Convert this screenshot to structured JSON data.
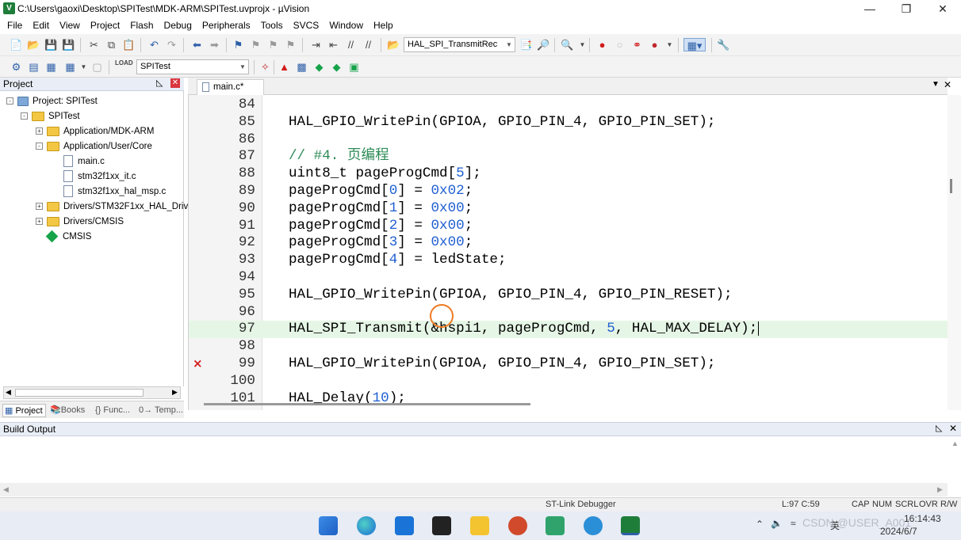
{
  "window": {
    "title": "C:\\Users\\gaoxi\\Desktop\\SPITest\\MDK-ARM\\SPITest.uvprojx - µVision",
    "icon": "V"
  },
  "watermark": "bilibili",
  "menu": [
    "File",
    "Edit",
    "View",
    "Project",
    "Flash",
    "Debug",
    "Peripherals",
    "Tools",
    "SVCS",
    "Window",
    "Help"
  ],
  "toolbar": {
    "find_combo": "HAL_SPI_TransmitRec",
    "target_combo": "SPITest"
  },
  "project_panel": {
    "title": "Project",
    "tree": [
      {
        "label": "Project: SPITest",
        "icon": "project-icon",
        "expander": "-"
      },
      {
        "label": "SPITest",
        "icon": "target-icon",
        "expander": "-"
      },
      {
        "label": "Application/MDK-ARM",
        "icon": "folder-icon",
        "expander": "+"
      },
      {
        "label": "Application/User/Core",
        "icon": "folder-icon",
        "expander": "-"
      },
      {
        "label": "main.c",
        "icon": "file-icon",
        "expander": ""
      },
      {
        "label": "stm32f1xx_it.c",
        "icon": "file-icon",
        "expander": ""
      },
      {
        "label": "stm32f1xx_hal_msp.c",
        "icon": "file-icon",
        "expander": ""
      },
      {
        "label": "Drivers/STM32F1xx_HAL_Driv",
        "icon": "folder-icon",
        "expander": "+"
      },
      {
        "label": "Drivers/CMSIS",
        "icon": "folder-icon",
        "expander": "+"
      },
      {
        "label": "CMSIS",
        "icon": "component-icon",
        "expander": ""
      }
    ],
    "tabs": [
      "Project",
      "Books",
      "{} Func...",
      "0→ Temp..."
    ]
  },
  "editor": {
    "tab_label": "main.c*",
    "lines": [
      {
        "num": "84",
        "text": ""
      },
      {
        "num": "85",
        "text": "HAL_GPIO_WritePin(GPIOA, GPIO_PIN_4, GPIO_PIN_SET);"
      },
      {
        "num": "86",
        "text": ""
      },
      {
        "num": "87",
        "text": "// #4. 页编程"
      },
      {
        "num": "88",
        "text": "uint8_t pageProgCmd[5];"
      },
      {
        "num": "89",
        "text": "pageProgCmd[0] = 0x02;"
      },
      {
        "num": "90",
        "text": "pageProgCmd[1] = 0x00;"
      },
      {
        "num": "91",
        "text": "pageProgCmd[2] = 0x00;"
      },
      {
        "num": "92",
        "text": "pageProgCmd[3] = 0x00;"
      },
      {
        "num": "93",
        "text": "pageProgCmd[4] = ledState;"
      },
      {
        "num": "94",
        "text": ""
      },
      {
        "num": "95",
        "text": "HAL_GPIO_WritePin(GPIOA, GPIO_PIN_4, GPIO_PIN_RESET);"
      },
      {
        "num": "96",
        "text": ""
      },
      {
        "num": "97",
        "text": "HAL_SPI_Transmit(&hspi1, pageProgCmd, 5, HAL_MAX_DELAY);"
      },
      {
        "num": "98",
        "text": ""
      },
      {
        "num": "99",
        "text": "HAL_GPIO_WritePin(GPIOA, GPIO_PIN_4, GPIO_PIN_SET);"
      },
      {
        "num": "100",
        "text": ""
      },
      {
        "num": "101",
        "text": "HAL_Delay(10);"
      }
    ],
    "highlight_line": "97",
    "error_line": "99",
    "error_marker": "×"
  },
  "build_output": {
    "title": "Build Output"
  },
  "status": {
    "debugger": "ST-Link Debugger",
    "position": "L:97 C:59",
    "indicators": [
      "CAP",
      "NUM",
      "SCRL",
      "OVR",
      "R/W"
    ]
  },
  "taskbar": {
    "ime": "英",
    "clock_time": "16:14:43",
    "clock_date": "2024/6/7",
    "tray_watermark": "CSDN @USER_A001"
  },
  "colors": {
    "highlight": "#e6f6e6",
    "comment": "#2e8b57",
    "number": "#1f5fd1",
    "error": "#d11a1a",
    "cursor_ring": "#f07a22"
  }
}
